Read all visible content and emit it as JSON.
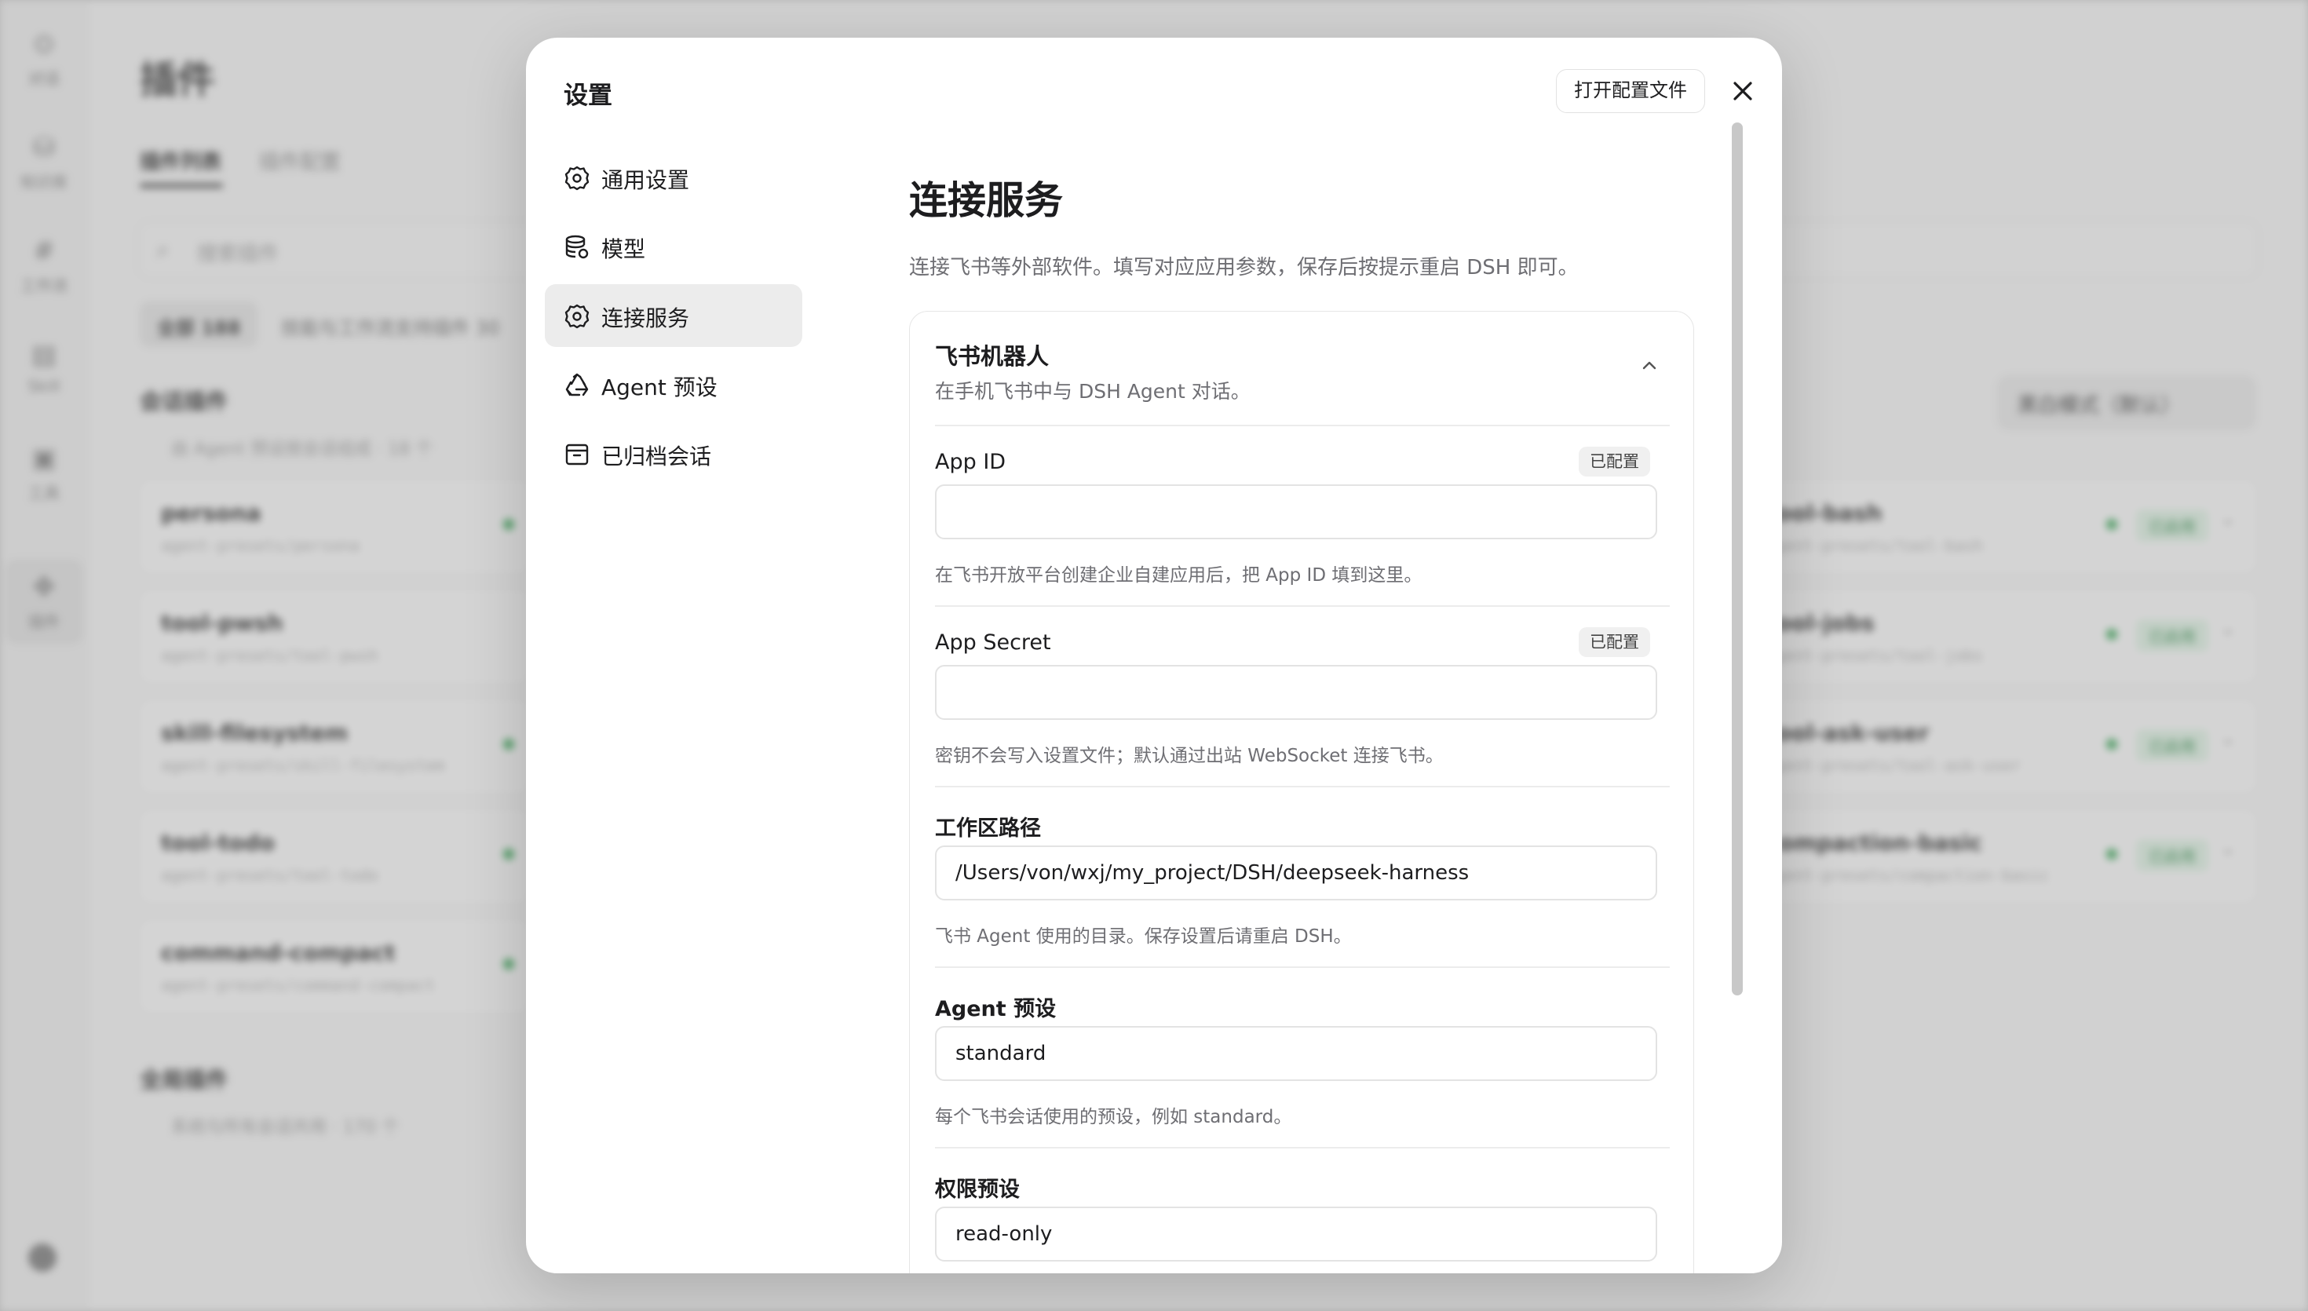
{
  "background": {
    "rail": {
      "items": [
        {
          "glyph": "⊙",
          "label": "对话"
        },
        {
          "glyph": "⛁",
          "label": "知识库"
        },
        {
          "glyph": "#",
          "label": "工作流"
        },
        {
          "glyph": "▤",
          "label": "Skill"
        },
        {
          "glyph": "▣",
          "label": "工具"
        },
        {
          "glyph": "✥",
          "label": "插件"
        }
      ]
    },
    "title": "插件",
    "tabs": [
      "插件列表",
      "插件配置"
    ],
    "search_placeholder": "搜索插件",
    "chips": [
      {
        "label": "全部 188"
      },
      {
        "label": "技能与工作流支持插件 30"
      }
    ],
    "group1": {
      "title": "会话插件",
      "sub": "由 Agent 预设按会话组成 · 18 个"
    },
    "group2": {
      "title": "全局插件",
      "sub": "系统与所有会话共用 · 170 个"
    },
    "mode": "黑白模式（默认）",
    "left_cards": [
      {
        "name": "persona",
        "path": "agent-presets/persona"
      },
      {
        "name": "tool-pwsh",
        "path": "agent-presets/tool-pwsh"
      },
      {
        "name": "skill-filesystem",
        "path": "agent-presets/skill-filesystem"
      },
      {
        "name": "tool-todo",
        "path": "agent-presets/tool-todo"
      },
      {
        "name": "command-compact",
        "path": "agent-presets/command-compact"
      }
    ],
    "right_cards": [
      {
        "name": "tool-bash",
        "path": "agent-presets/tool-bash",
        "status": "已启用"
      },
      {
        "name": "tool-jobs",
        "path": "agent-presets/tool-jobs",
        "status": "已启用"
      },
      {
        "name": "tool-ask-user",
        "path": "agent-presets/tool-ask-user",
        "status": "已启用"
      },
      {
        "name": "compaction-basic",
        "path": "agent-presets/compaction-basic",
        "status": "已启用"
      }
    ]
  },
  "modal": {
    "title": "设置",
    "open_config_label": "打开配置文件",
    "close_icon": "close-icon",
    "nav": [
      {
        "label": "通用设置",
        "icon": "gear-icon"
      },
      {
        "label": "模型",
        "icon": "database-gear-icon"
      },
      {
        "label": "连接服务",
        "icon": "gear-icon",
        "active": true
      },
      {
        "label": "Agent 预设",
        "icon": "recycle-icon"
      },
      {
        "label": "已归档会话",
        "icon": "archive-icon"
      }
    ],
    "page": {
      "heading": "连接服务",
      "description": "连接飞书等外部软件。填写对应应用参数，保存后按提示重启 DSH 即可。",
      "section": {
        "title": "飞书机器人",
        "subtitle": "在手机飞书中与 DSH Agent 对话。",
        "fields": [
          {
            "label": "App ID",
            "status": "已配置",
            "value": "",
            "help": "在飞书开放平台创建企业自建应用后，把 App ID 填到这里。"
          },
          {
            "label": "App Secret",
            "status": "已配置",
            "value": "",
            "help": "密钥不会写入设置文件；默认通过出站 WebSocket 连接飞书。"
          },
          {
            "label": "工作区路径",
            "value": "/Users/von/wxj/my_project/DSH/deepseek-harness",
            "help": "飞书 Agent 使用的目录。保存设置后请重启 DSH。"
          },
          {
            "label": "Agent 预设",
            "value": "standard",
            "help": "每个飞书会话使用的预设，例如 standard。"
          },
          {
            "label": "权限预设",
            "value": "read-only"
          }
        ]
      }
    }
  }
}
